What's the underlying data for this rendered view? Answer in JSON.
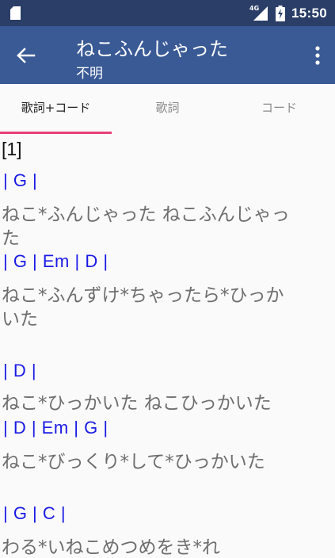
{
  "status_bar": {
    "network_label": "4G",
    "time": "15:50"
  },
  "app_bar": {
    "title": "ねこふんじゃった",
    "subtitle": "不明"
  },
  "tabs": [
    {
      "label": "歌詞+コード",
      "active": true
    },
    {
      "label": "歌詞",
      "active": false
    },
    {
      "label": "コード",
      "active": false
    }
  ],
  "content": {
    "section": "[1]",
    "lines": [
      {
        "type": "chord",
        "text": "| G |"
      },
      {
        "type": "lyric",
        "text": "ねこ*ふんじゃった ねこふんじゃっ"
      },
      {
        "type": "lyric",
        "text": "た"
      },
      {
        "type": "chord",
        "text": "| G | Em | D |"
      },
      {
        "type": "lyric",
        "text": "ねこ*ふんずけ*ちゃったら*ひっか"
      },
      {
        "type": "lyric",
        "text": "いた"
      },
      {
        "type": "chord",
        "text": "| D |"
      },
      {
        "type": "lyric",
        "text": "ねこ*ひっかいた ねこひっかいた"
      },
      {
        "type": "chord",
        "text": "| D | Em | G |"
      },
      {
        "type": "lyric",
        "text": "ねこ*びっくり*して*ひっかいた"
      },
      {
        "type": "chord",
        "text": "| G | C |"
      },
      {
        "type": "lyric",
        "text": "わる*いねこめつめをき*れ"
      }
    ]
  },
  "colors": {
    "status_bar": "#2a3e68",
    "app_bar": "#3a5a96",
    "tab_indicator": "#e8417a",
    "chord_text": "#1a1ae6",
    "lyric_text": "#6e6e6e"
  }
}
